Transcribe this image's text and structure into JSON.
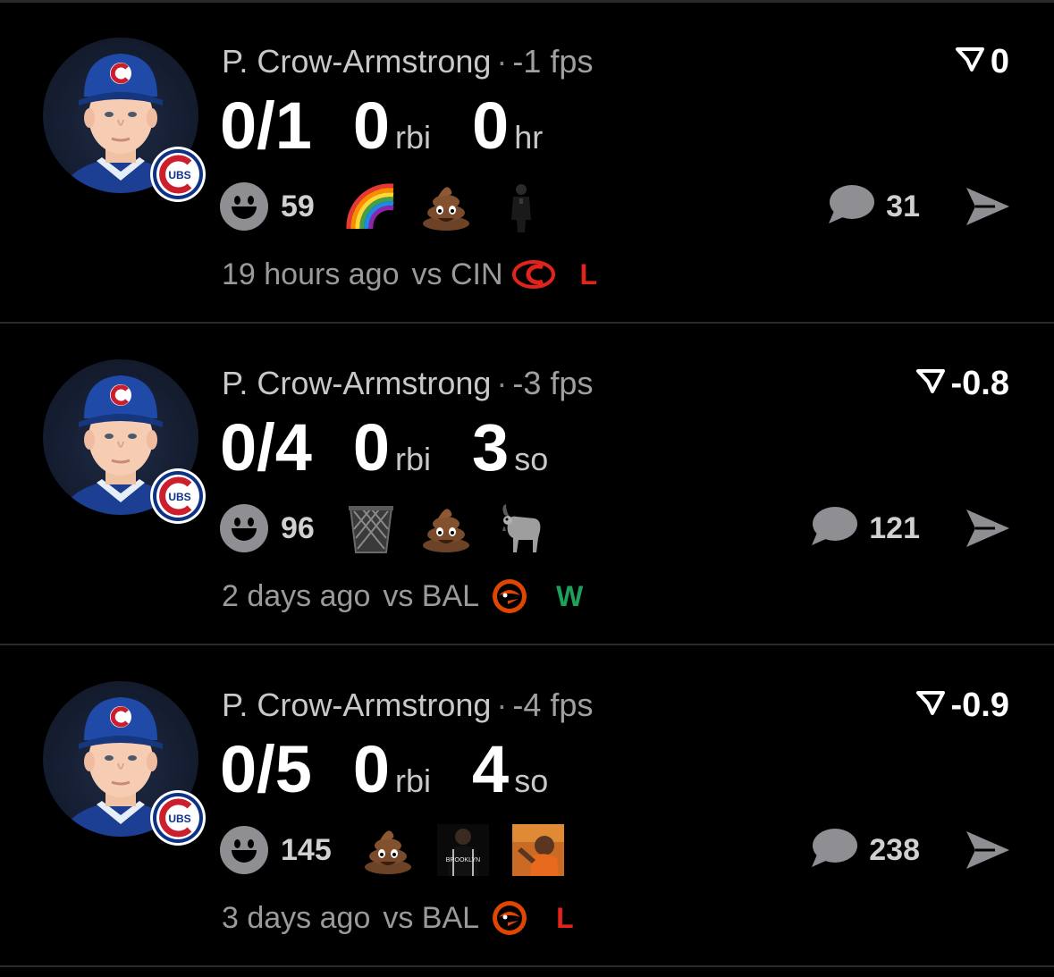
{
  "colors": {
    "background": "#000000",
    "loss": "#e0241b",
    "win": "#1fa05a",
    "muted": "#9a9a9a"
  },
  "cards": [
    {
      "player": "P. Crow-Armstrong",
      "separator": "·",
      "fps": "-1 fps",
      "score": "0",
      "hits": "0/1",
      "stat2_value": "0",
      "stat2_unit": "rbi",
      "stat3_value": "0",
      "stat3_unit": "hr",
      "reaction_count": "59",
      "emojis": [
        "rainbow-icon",
        "poop-icon",
        "person-in-black-icon"
      ],
      "comment_count": "31",
      "time": "19 hours ago",
      "vs": "vs CIN",
      "opponent_logo": "reds-logo-icon",
      "result": "L",
      "result_color": "#e0241b"
    },
    {
      "player": "P. Crow-Armstrong",
      "separator": "·",
      "fps": "-3 fps",
      "score": "-0.8",
      "hits": "0/4",
      "stat2_value": "0",
      "stat2_unit": "rbi",
      "stat3_value": "3",
      "stat3_unit": "so",
      "reaction_count": "96",
      "emojis": [
        "wastebasket-icon",
        "poop-icon",
        "goat-icon"
      ],
      "comment_count": "121",
      "time": "2 days ago",
      "vs": "vs BAL",
      "opponent_logo": "orioles-logo-icon",
      "result": "W",
      "result_color": "#1fa05a"
    },
    {
      "player": "P. Crow-Armstrong",
      "separator": "·",
      "fps": "-4 fps",
      "score": "-0.9",
      "hits": "0/5",
      "stat2_value": "0",
      "stat2_unit": "rbi",
      "stat3_value": "4",
      "stat3_unit": "so",
      "reaction_count": "145",
      "emojis": [
        "poop-icon",
        "brooklyn-player-icon",
        "drake-meme-icon"
      ],
      "comment_count": "238",
      "time": "3 days ago",
      "vs": "vs BAL",
      "opponent_logo": "orioles-logo-icon",
      "result": "L",
      "result_color": "#e0241b"
    }
  ]
}
